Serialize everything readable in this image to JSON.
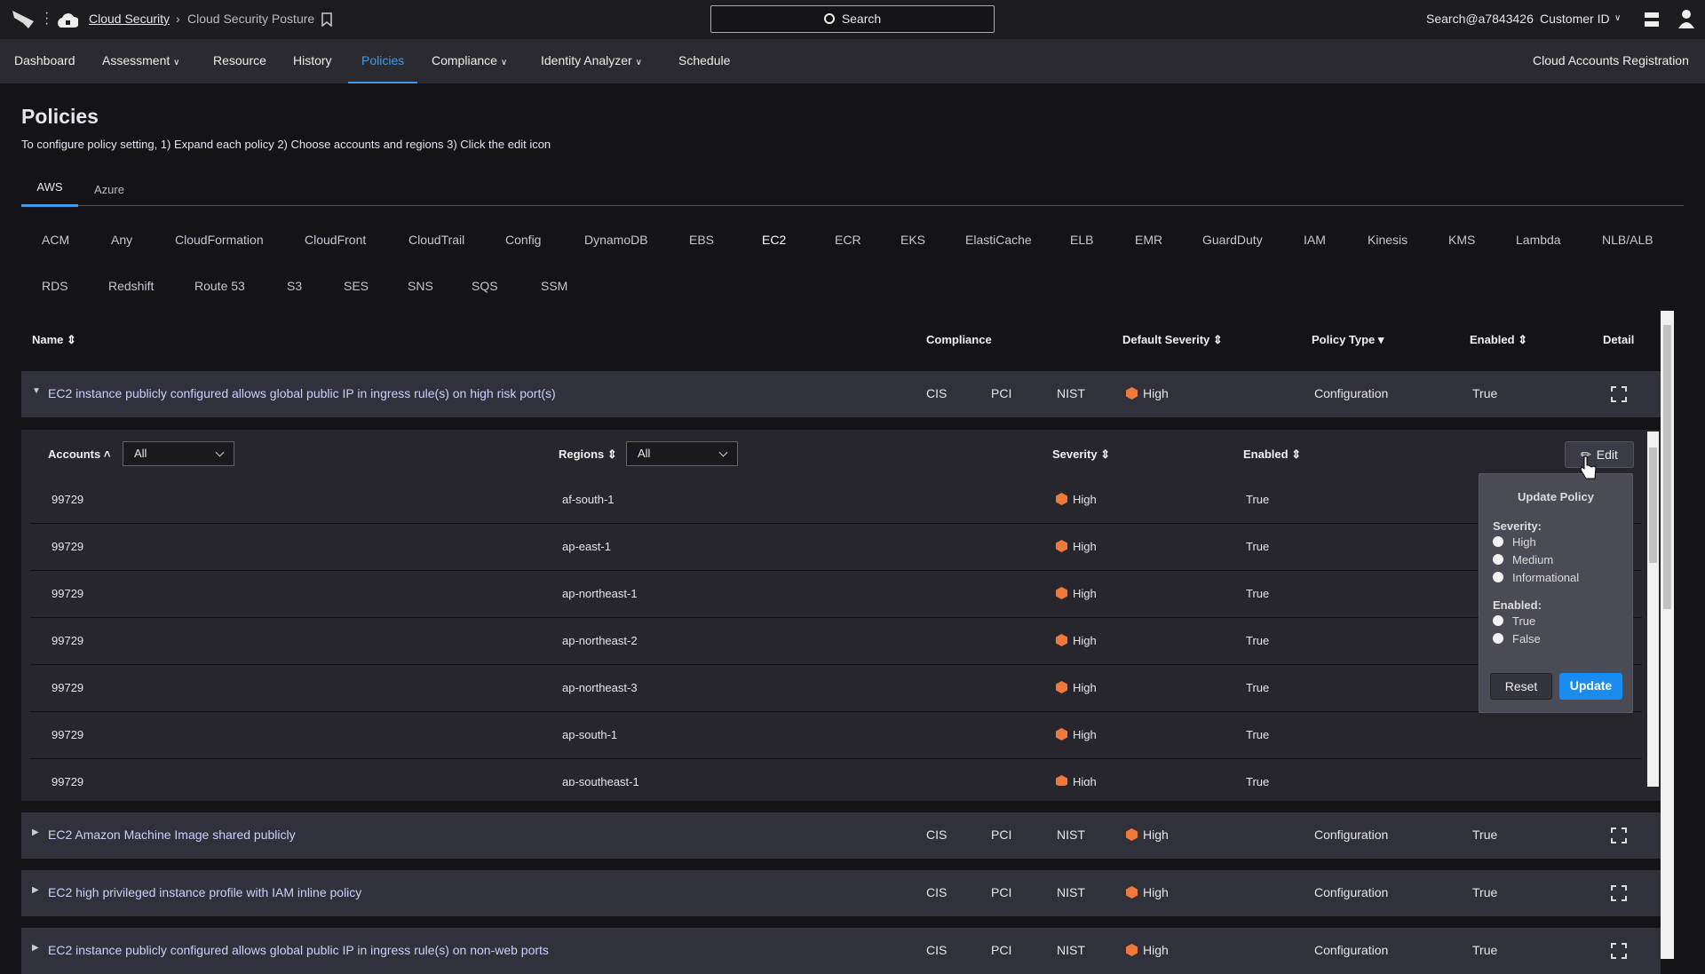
{
  "topbar": {
    "breadcrumb_root": "Cloud Security",
    "breadcrumb_current": "Cloud Security Posture",
    "search_label": "Search",
    "user": "Search@a7843426",
    "customer": "Customer ID"
  },
  "nav": {
    "items": [
      "Dashboard",
      "Assessment",
      "Resource",
      "History",
      "Policies",
      "Compliance",
      "Identity Analyzer",
      "Schedule"
    ],
    "active": "Policies",
    "right": "Cloud Accounts Registration"
  },
  "page": {
    "title": "Policies",
    "subtitle": "To configure policy setting, 1) Expand each policy 2) Choose accounts and regions 3) Click the edit icon"
  },
  "cloud_tabs": [
    "AWS",
    "Azure"
  ],
  "services_row1": [
    "ACM",
    "Any",
    "CloudFormation",
    "CloudFront",
    "CloudTrail",
    "Config",
    "DynamoDB",
    "EBS",
    "EC2",
    "ECR",
    "EKS",
    "ElastiCache",
    "ELB",
    "EMR",
    "GuardDuty",
    "IAM",
    "Kinesis",
    "KMS",
    "Lambda",
    "NLB/ALB"
  ],
  "services_row2": [
    "RDS",
    "Redshift",
    "Route 53",
    "S3",
    "SES",
    "SNS",
    "SQS",
    "SSM"
  ],
  "selected_service": "EC2",
  "colors": {
    "accent": "#3d9cf0",
    "high": "#f0783a",
    "update_button": "#1a8cf0"
  },
  "table": {
    "headers": {
      "name": "Name",
      "compliance": "Compliance",
      "severity": "Default Severity",
      "type": "Policy Type",
      "enabled": "Enabled",
      "detail": "Detail"
    },
    "policies": [
      {
        "name": "EC2 instance publicly configured allows global public IP in ingress rule(s) on high risk port(s)",
        "c1": "CIS",
        "c2": "PCI",
        "c3": "NIST",
        "severity": "High",
        "type": "Configuration",
        "enabled": "True",
        "expanded": true
      },
      {
        "name": "EC2 Amazon Machine Image shared publicly",
        "c1": "CIS",
        "c2": "PCI",
        "c3": "NIST",
        "severity": "High",
        "type": "Configuration",
        "enabled": "True"
      },
      {
        "name": "EC2 high privileged instance profile with IAM inline policy",
        "c1": "CIS",
        "c2": "PCI",
        "c3": "NIST",
        "severity": "High",
        "type": "Configuration",
        "enabled": "True"
      },
      {
        "name": "EC2 instance publicly configured allows global public IP in ingress rule(s) on non-web ports",
        "c1": "CIS",
        "c2": "PCI",
        "c3": "NIST",
        "severity": "High",
        "type": "Configuration",
        "enabled": "True"
      }
    ]
  },
  "nested": {
    "headers": {
      "accounts": "Accounts",
      "regions": "Regions",
      "severity": "Severity",
      "enabled": "Enabled"
    },
    "accounts_filter": "All",
    "regions_filter": "All",
    "edit_label": "Edit",
    "rows": [
      {
        "account": "99729",
        "region": "af-south-1",
        "severity": "High",
        "enabled": "True"
      },
      {
        "account": "99729",
        "region": "ap-east-1",
        "severity": "High",
        "enabled": "True"
      },
      {
        "account": "99729",
        "region": "ap-northeast-1",
        "severity": "High",
        "enabled": "True"
      },
      {
        "account": "99729",
        "region": "ap-northeast-2",
        "severity": "High",
        "enabled": "True"
      },
      {
        "account": "99729",
        "region": "ap-northeast-3",
        "severity": "High",
        "enabled": "True"
      },
      {
        "account": "99729",
        "region": "ap-south-1",
        "severity": "High",
        "enabled": "True"
      },
      {
        "account": "99729",
        "region": "ap-southeast-1",
        "severity": "High",
        "enabled": "True"
      }
    ]
  },
  "popup": {
    "title": "Update Policy",
    "severity_label": "Severity:",
    "severity_options": [
      "High",
      "Medium",
      "Informational"
    ],
    "enabled_label": "Enabled:",
    "enabled_options": [
      "True",
      "False"
    ],
    "reset": "Reset",
    "update": "Update"
  }
}
